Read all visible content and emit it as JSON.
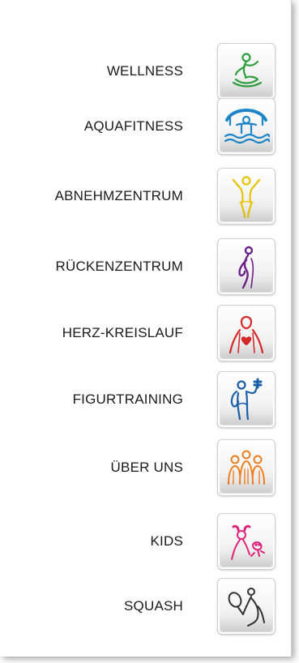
{
  "menu": {
    "items": [
      {
        "label": "WELLNESS",
        "icon": "yoga-meditation-icon",
        "color": "#2e9e3e"
      },
      {
        "label": "AQUAFITNESS",
        "icon": "swimmer-pool-icon",
        "color": "#1e86c8"
      },
      {
        "label": "ABNEHMZENTRUM",
        "icon": "slim-body-icon",
        "color": "#e8c400"
      },
      {
        "label": "RÜCKENZENTRUM",
        "icon": "back-posture-icon",
        "color": "#6b1f8a"
      },
      {
        "label": "HERZ-KREISLAUF",
        "icon": "heart-torso-icon",
        "color": "#d62a2a"
      },
      {
        "label": "FIGURTRAINING",
        "icon": "dumbbell-athlete-icon",
        "color": "#1b5fa8"
      },
      {
        "label": "ÜBER UNS",
        "icon": "group-people-icon",
        "color": "#ee7d1e"
      },
      {
        "label": "KIDS",
        "icon": "kids-icon",
        "color": "#e0237a"
      },
      {
        "label": "SQUASH",
        "icon": "squash-player-icon",
        "color": "#333333"
      }
    ]
  }
}
